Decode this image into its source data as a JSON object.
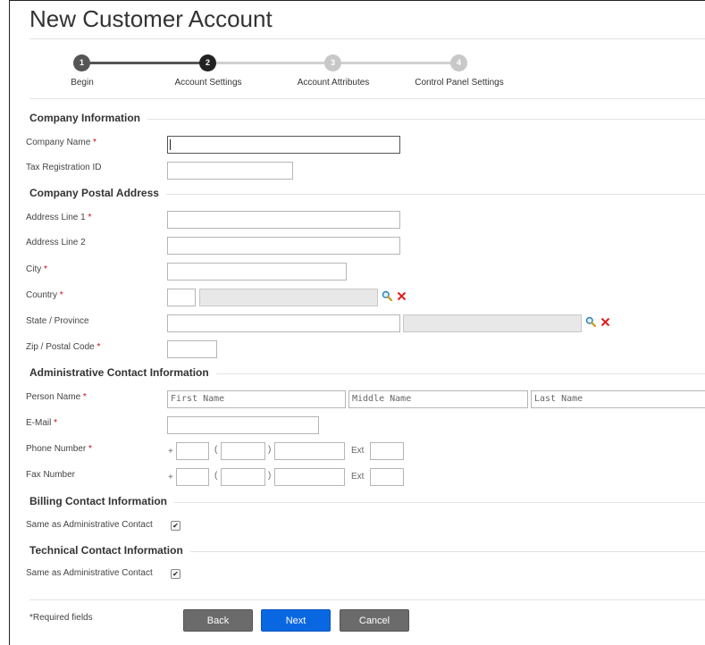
{
  "page": {
    "title": "New Customer Account"
  },
  "wizard": {
    "steps": [
      {
        "number": "1",
        "label": "Begin"
      },
      {
        "number": "2",
        "label": "Account Settings"
      },
      {
        "number": "3",
        "label": "Account Attributes"
      },
      {
        "number": "4",
        "label": "Control Panel Settings"
      }
    ],
    "colors": {
      "complete": "#555555",
      "active": "#222222",
      "pending": "#c8c8c8"
    }
  },
  "sections": {
    "company_info": "Company Information",
    "postal_address": "Company Postal Address",
    "admin_contact": "Administrative Contact Information",
    "billing_contact": "Billing Contact Information",
    "technical_contact": "Technical Contact Information"
  },
  "fields": {
    "company_name": {
      "label": "Company Name",
      "required": "*",
      "value": ""
    },
    "tax_id": {
      "label": "Tax Registration ID",
      "value": ""
    },
    "address1": {
      "label": "Address Line 1",
      "required": "*",
      "value": ""
    },
    "address2": {
      "label": "Address Line 2",
      "value": ""
    },
    "city": {
      "label": "City",
      "required": "*",
      "value": ""
    },
    "country": {
      "label": "Country",
      "required": "*",
      "code": "",
      "name": ""
    },
    "state": {
      "label": "State / Province",
      "value": "",
      "name": ""
    },
    "zip": {
      "label": "Zip / Postal Code",
      "required": "*",
      "value": ""
    },
    "person_name": {
      "label": "Person Name",
      "required": "*",
      "first_placeholder": "First Name",
      "middle_placeholder": "Middle Name",
      "last_placeholder": "Last Name"
    },
    "email": {
      "label": "E-Mail",
      "required": "*",
      "value": ""
    },
    "phone": {
      "label": "Phone Number",
      "required": "*",
      "plus": "+",
      "open_paren": "(",
      "close_paren": ")",
      "ext": "Ext"
    },
    "fax": {
      "label": "Fax Number",
      "plus": "+",
      "open_paren": "(",
      "close_paren": ")",
      "ext": "Ext"
    },
    "billing_same": {
      "label": "Same as Administrative Contact",
      "checked": true,
      "mark": "✔"
    },
    "technical_same": {
      "label": "Same as Administrative Contact",
      "checked": true,
      "mark": "✔"
    }
  },
  "footer": {
    "required_note": "*Required fields",
    "back_label": "Back",
    "next_label": "Next",
    "cancel_label": "Cancel"
  },
  "icons": {
    "search": "magnifier-icon",
    "clear": "red-x-icon"
  },
  "colors": {
    "primary_button": "#0a67e2",
    "secondary_button": "#6b6b6b",
    "required": "#d0021b",
    "clear_x": "#e02020"
  }
}
